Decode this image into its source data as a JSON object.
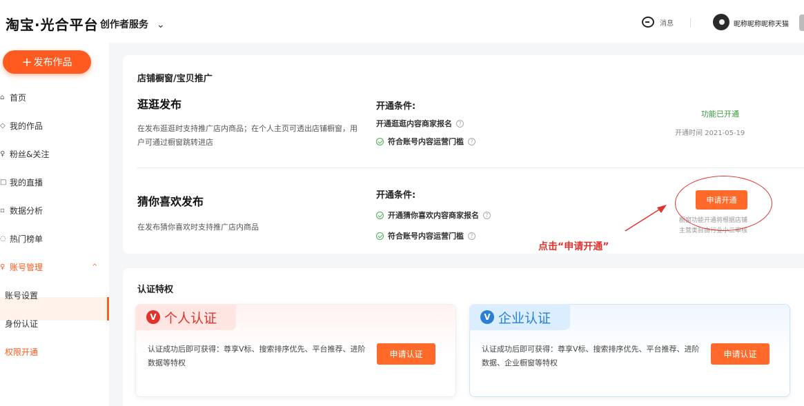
{
  "header": {
    "logo": "淘宝·光合平台",
    "service": "创作者服务",
    "service_chevron": "⌄",
    "message_label": "消息",
    "username": "昵称昵称昵称天猫"
  },
  "sidebar": {
    "publish_label": "发布作品",
    "publish_plus": "+",
    "items": [
      {
        "label": "首页",
        "icon": "⌂"
      },
      {
        "label": "我的作品",
        "icon": "◇"
      },
      {
        "label": "粉丝&关注",
        "icon": "♀"
      },
      {
        "label": "我的直播",
        "icon": "□"
      },
      {
        "label": "数据分析",
        "icon": "▫"
      },
      {
        "label": "热门榜单",
        "icon": "◌"
      },
      {
        "label": "账号管理",
        "icon": "♀",
        "chevron": "^"
      }
    ],
    "sub_items": [
      {
        "label": "账号设置"
      },
      {
        "label": "身份认证"
      },
      {
        "label": "权限开通"
      }
    ]
  },
  "promo": {
    "section_title": "店铺橱窗/宝贝推广",
    "features": [
      {
        "title": "逛逛发布",
        "desc": "在发布逛逛时支持推广店内商品；在个人主页可透出店铺橱窗，用户可通过橱窗跳转进店",
        "cond_title": "开通条件:",
        "conds": [
          "开通逛逛内容商家报名",
          "符合账号内容运营门槛"
        ],
        "status": "功能已开通",
        "time": "开通时间 2021-05-19"
      },
      {
        "title": "猜你喜欢发布",
        "desc": "在发布猜你喜欢时支持推广店内商品",
        "cond_title": "开通条件:",
        "conds": [
          "开通猜你喜欢内容商家报名",
          "符合账号内容运营门槛"
        ],
        "button": "申请开通",
        "note_line1": "橱窗功能开通将根据店铺",
        "note_line2": "主营类目由行业小二审核"
      }
    ],
    "annotation": "点击“申请开通”",
    "help_glyph": "?"
  },
  "cert": {
    "section_title": "认证特权",
    "v_glyph": "V",
    "personal": {
      "title": "个人认证",
      "desc": "认证成功后即可获得：尊享V标、搜索排序优先、平台推荐、进阶数据等特权",
      "button": "申请认证"
    },
    "company": {
      "title": "企业认证",
      "desc": "认证成功后即可获得：尊享V标、搜索排序优先、平台推荐、进阶数据、企业橱窗等特权",
      "button": "申请认证"
    }
  },
  "colors": {
    "accent": "#ff5a1f",
    "success": "#3b9a3b",
    "annotation": "#e0332d",
    "company_blue": "#2a7fd4"
  }
}
